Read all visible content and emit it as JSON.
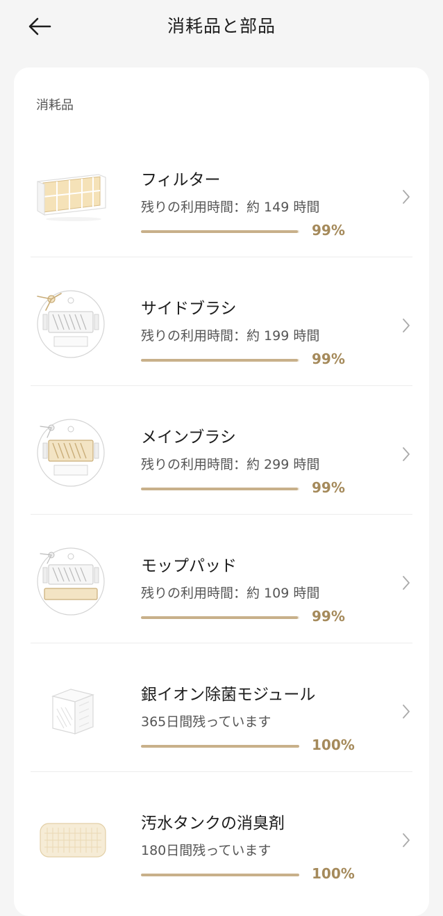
{
  "header": {
    "title": "消耗品と部品",
    "back_icon": "arrow-left-icon"
  },
  "section": {
    "title": "消耗品"
  },
  "colors": {
    "accent": "#a58a5b",
    "bar": "#c8b08a",
    "bar_track": "#ece4d6"
  },
  "items": [
    {
      "name": "フィルター",
      "remaining": "残りの利用時間：約 149 時間",
      "percent_label": "99%",
      "percent": 99,
      "icon": "filter-icon"
    },
    {
      "name": "サイドブラシ",
      "remaining": "残りの利用時間：約 199 時間",
      "percent_label": "99%",
      "percent": 99,
      "icon": "side-brush-robot-icon"
    },
    {
      "name": "メインブラシ",
      "remaining": "残りの利用時間：約 299 時間",
      "percent_label": "99%",
      "percent": 99,
      "icon": "main-brush-robot-icon"
    },
    {
      "name": "モップパッド",
      "remaining": "残りの利用時間：約 109 時間",
      "percent_label": "99%",
      "percent": 99,
      "icon": "mop-pad-robot-icon"
    },
    {
      "name": "銀イオン除菌モジュール",
      "remaining": "365日間残っています",
      "percent_label": "100%",
      "percent": 100,
      "icon": "silver-ion-module-icon"
    },
    {
      "name": "汚水タンクの消臭剤",
      "remaining": "180日間残っています",
      "percent_label": "100%",
      "percent": 100,
      "icon": "deodorizer-icon"
    }
  ]
}
